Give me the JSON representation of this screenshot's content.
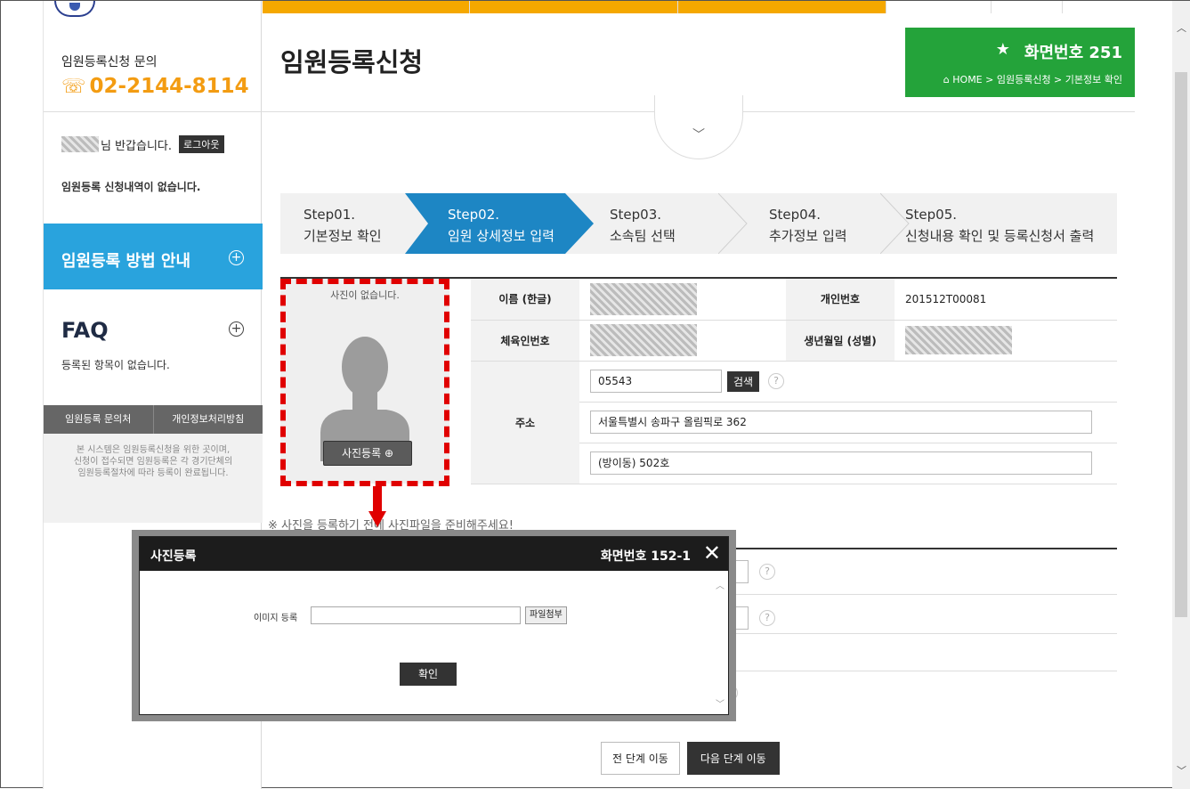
{
  "sidebar": {
    "inquiry_title": "임원등록신청 문의",
    "phone": "02-2144-8114",
    "greeting_suffix": "님 반갑습니다.",
    "logout_label": "로그아웃",
    "no_application": "임원등록 신청내역이 없습니다.",
    "guide_label": "임원등록 방법 안내",
    "faq_title": "FAQ",
    "faq_empty": "등록된 항목이 없습니다.",
    "tab_contact": "임원등록 문의처",
    "tab_privacy": "개인정보처리방침",
    "info_lines": [
      "본 시스템은 임원등록신청을 위한 곳이며,",
      "신청이 접수되면 임원등록은 각 경기단체의",
      "임원등록절차에 따라 등록이 완료됩니다."
    ]
  },
  "header": {
    "page_title": "임원등록신청",
    "screen_number": "화면번호 251",
    "breadcrumb": "HOME > 임원등록신청 > 기본정보 확인",
    "accent_color": "#24a33a"
  },
  "steps": [
    {
      "num": "Step01.",
      "label": "기본정보 확인",
      "active": false
    },
    {
      "num": "Step02.",
      "label": "임원 상세정보 입력",
      "active": true
    },
    {
      "num": "Step03.",
      "label": "소속팀 선택",
      "active": false
    },
    {
      "num": "Step04.",
      "label": "추가정보 입력",
      "active": false
    },
    {
      "num": "Step05.",
      "label": "신청내용 확인 및 등록신청서 출력",
      "active": false
    }
  ],
  "photo": {
    "no_photo": "사진이 없습니다.",
    "register_label": "사진등록"
  },
  "form": {
    "name_label": "이름 (한글)",
    "personal_no_label": "개인번호",
    "personal_no_value": "201512T00081",
    "athlete_no_label": "체육인번호",
    "birth_label": "생년월일 (성별)",
    "address_label": "주소",
    "zip_value": "05543",
    "search_label": "검색",
    "address1_value": "서울특별시 송파구 올림픽로 362",
    "address2_value": "(방이동) 502호"
  },
  "notice": "※ 사진을 등록하기 전에 사진파일을 준비해주세요!",
  "buttons": {
    "prev": "전 단계 이동",
    "next": "다음 단계 이동"
  },
  "modal": {
    "title": "사진등록",
    "screen_number": "화면번호 152-1",
    "image_label": "이미지 등록",
    "file_button": "파일첨부",
    "ok_button": "확인"
  }
}
